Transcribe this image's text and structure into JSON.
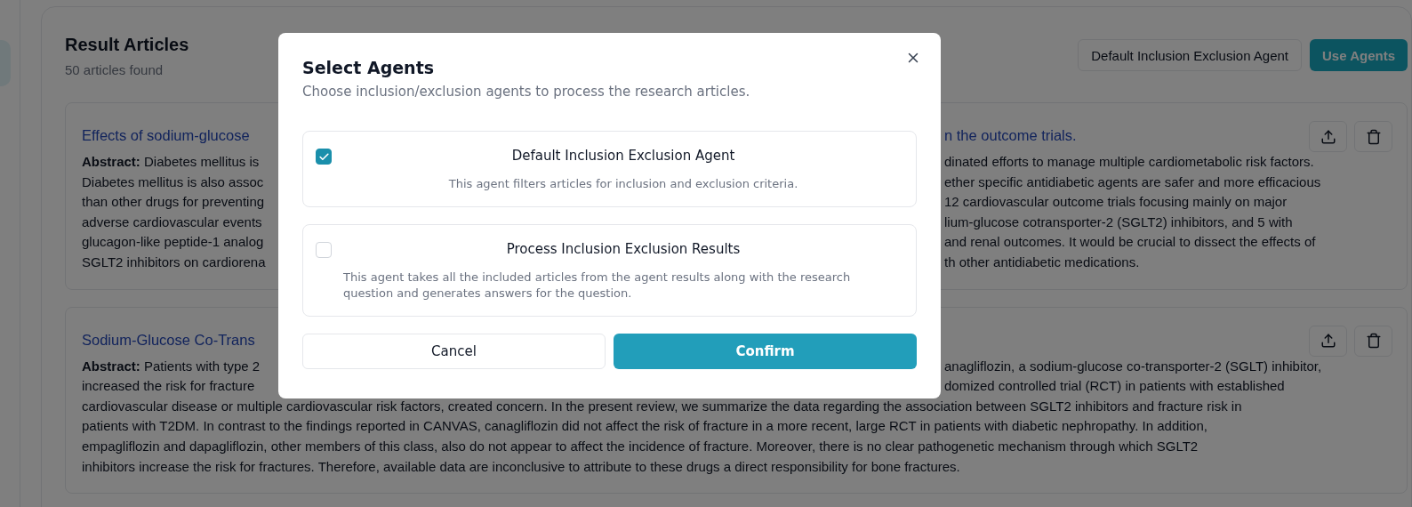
{
  "header": {
    "title": "Result Articles",
    "subtitle": "50 articles found"
  },
  "toolbar_buttons": [
    {
      "label": "Default Inclusion Exclusion Agent",
      "kind": "outline"
    },
    {
      "label": "Use Agents",
      "kind": "primary"
    }
  ],
  "articles": [
    {
      "title": {
        "left": "Effects of sodium-glucose",
        "right": "n the outcome trials."
      },
      "lines": [
        {
          "left": "**Abstract:** Diabetes mellitus is",
          "right": "dinated efforts to manage multiple cardiometabolic risk factors."
        },
        {
          "left": "Diabetes mellitus is also assoc",
          "right": "ether specific antidiabetic agents are safer and more efficacious"
        },
        {
          "left": "than other drugs for preventing",
          "right": "12 cardiovascular outcome trials focusing mainly on major"
        },
        {
          "left": "adverse cardiovascular events",
          "right": "lium-glucose cotransporter-2 (SGLT2) inhibitors, and 5 with"
        },
        {
          "left": "glucagon-like peptide-1 analog",
          "right": "and renal outcomes. It would be crucial to dissect the effects of"
        },
        {
          "left": "SGLT2 inhibitors on cardiorena",
          "right": "th other antidiabetic medications."
        }
      ]
    },
    {
      "title": {
        "left": "Sodium-Glucose Co-Trans"
      },
      "lines": [
        {
          "left": "**Abstract:** Patients with type 2",
          "right": "anagliflozin, a sodium-glucose co-transporter-2 (SGLT) inhibitor,"
        },
        {
          "left": "increased the risk for fracture",
          "right": "domized controlled trial (RCT) in patients with established"
        },
        {
          "text": "cardiovascular disease or multiple cardiovascular risk factors, created concern. In the present review, we summarize the data regarding the association between SGLT2 inhibitors and fracture risk in"
        },
        {
          "text": "patients with T2DM. In contrast to the findings reported in CANVAS, canagliflozin did not affect the risk of fracture in a more recent, large RCT in patients with diabetic nephropathy. In addition,"
        },
        {
          "text": "empagliflozin and dapagliflozin, other members of this class, also do not appear to affect the incidence of fracture. Moreover, there is no clear pathogenetic mechanism through which SGLT2"
        },
        {
          "text": "inhibitors increase the risk for fractures. Therefore, available data are inconclusive to attribute to these drugs a direct responsibility for bone fractures."
        }
      ]
    }
  ],
  "dialog": {
    "title": "Select Agents",
    "subtitle": "Choose inclusion/exclusion agents to process the research articles.",
    "agents": [
      {
        "name": "Default Inclusion Exclusion Agent",
        "description": "This agent filters articles for inclusion and exclusion criteria.",
        "checked": true
      },
      {
        "name": "Process Inclusion Exclusion Results",
        "description": "This agent takes all the included articles from the agent results along with the research question and generates answers for the question.",
        "checked": false
      }
    ],
    "buttons": [
      {
        "label": "Cancel",
        "kind": "secondary"
      },
      {
        "label": "Confirm",
        "kind": "primary"
      }
    ]
  }
}
